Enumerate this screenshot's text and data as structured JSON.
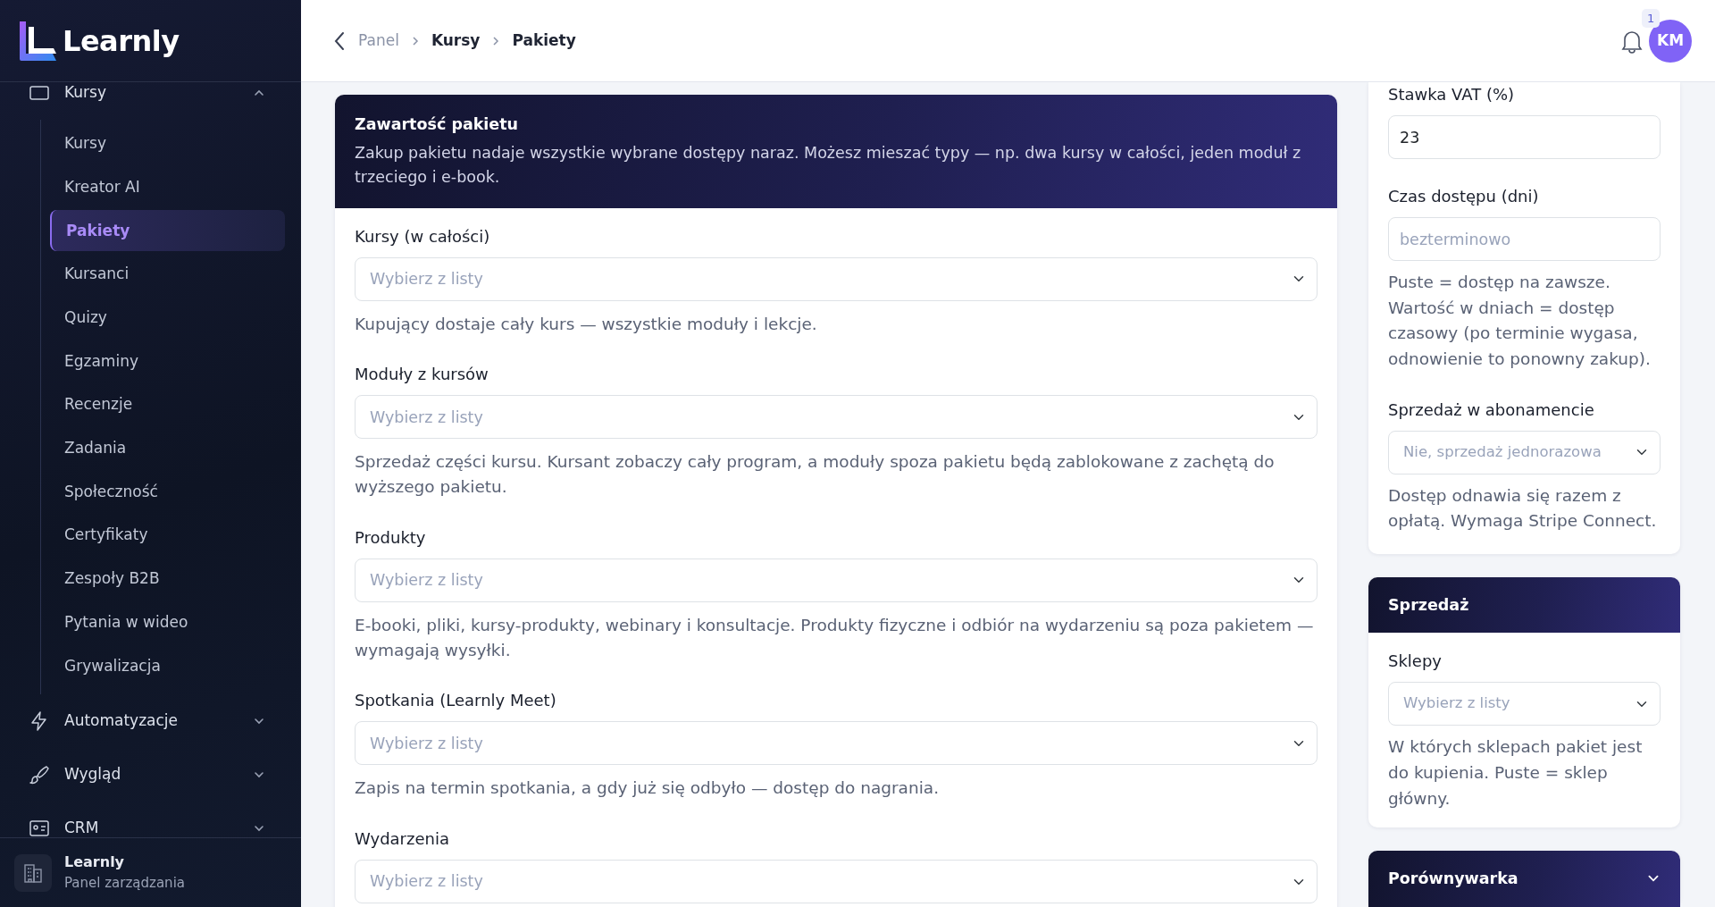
{
  "sidebar": {
    "brand": "Learnly",
    "nav": [
      {
        "label": "Kursy",
        "expanded": true,
        "children": [
          {
            "label": "Kursy",
            "selected": false
          },
          {
            "label": "Kreator AI",
            "selected": false
          },
          {
            "label": "Pakiety",
            "selected": true
          },
          {
            "label": "Kursanci",
            "selected": false
          },
          {
            "label": "Quizy",
            "selected": false
          },
          {
            "label": "Egzaminy",
            "selected": false
          },
          {
            "label": "Recenzje",
            "selected": false
          },
          {
            "label": "Zadania",
            "selected": false
          },
          {
            "label": "Społeczność",
            "selected": false
          },
          {
            "label": "Certyfikaty",
            "selected": false
          },
          {
            "label": "Zespoły B2B",
            "selected": false
          },
          {
            "label": "Pytania w wideo",
            "selected": false
          },
          {
            "label": "Grywalizacja",
            "selected": false
          }
        ]
      },
      {
        "label": "Automatyzacje",
        "expanded": false
      },
      {
        "label": "Wygląd",
        "expanded": false
      },
      {
        "label": "CRM",
        "expanded": false
      }
    ],
    "footer": {
      "title": "Learnly",
      "subtitle": "Panel zarządzania"
    }
  },
  "header": {
    "breadcrumb": [
      {
        "label": "Panel",
        "bold": false
      },
      {
        "label": "Kursy",
        "bold": true
      },
      {
        "label": "Pakiety",
        "bold": true
      }
    ],
    "notifications": "1",
    "avatar": "KM"
  },
  "content_card": {
    "title": "Zawartość pakietu",
    "description": "Zakup pakietu nadaje wszystkie wybrane dostępy naraz. Możesz mieszać typy — np. dwa kursy w całości, jeden moduł z trzeciego i e-book.",
    "fields": [
      {
        "label": "Kursy (w całości)",
        "placeholder": "Wybierz z listy",
        "help": "Kupujący dostaje cały kurs — wszystkie moduły i lekcje."
      },
      {
        "label": "Moduły z kursów",
        "placeholder": "Wybierz z listy",
        "help": "Sprzedaż części kursu. Kursant zobaczy cały program, a moduły spoza pakietu będą zablokowane z zachętą do wyższego pakietu."
      },
      {
        "label": "Produkty",
        "placeholder": "Wybierz z listy",
        "help": "E-booki, pliki, kursy-produkty, webinary i konsultacje. Produkty fizyczne i odbiór na wydarzeniu są poza pakietem — wymagają wysyłki."
      },
      {
        "label": "Spotkania (Learnly Meet)",
        "placeholder": "Wybierz z listy",
        "help": "Zapis na termin spotkania, a gdy już się odbyło — dostęp do nagrania."
      },
      {
        "label": "Wydarzenia",
        "placeholder": "Wybierz z listy"
      }
    ]
  },
  "settings_card": {
    "fields": [
      {
        "kind": "input",
        "label": "Stawka VAT (%)",
        "value": "23"
      },
      {
        "kind": "input",
        "label": "Czas dostępu (dni)",
        "placeholder": "bezterminowo",
        "help": "Puste = dostęp na zawsze. Wartość w dniach = dostęp czasowy (po terminie wygasa, odnowienie to ponowny zakup)."
      },
      {
        "kind": "select",
        "label": "Sprzedaż w abonamencie",
        "placeholder": "Nie, sprzedaż jednorazowa",
        "help": "Dostęp odnawia się razem z opłatą. Wymaga Stripe Connect."
      }
    ]
  },
  "sales_card": {
    "title": "Sprzedaż",
    "fields": [
      {
        "kind": "select",
        "label": "Sklepy",
        "placeholder": "Wybierz z listy",
        "help": "W których sklepach pakiet jest do kupienia. Puste = sklep główny."
      }
    ]
  },
  "comparison_card": {
    "title": "Porównywarka",
    "expanded": false
  }
}
